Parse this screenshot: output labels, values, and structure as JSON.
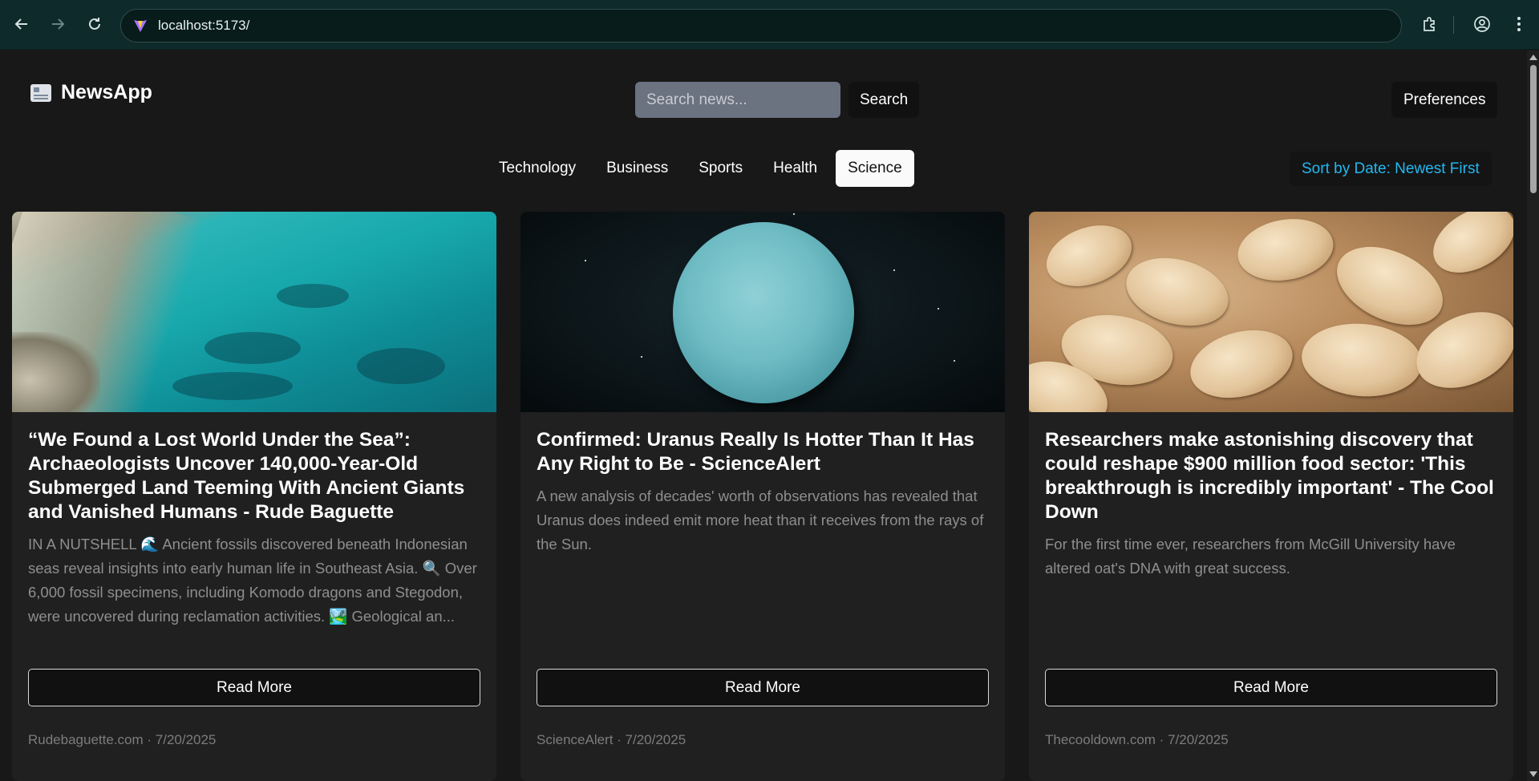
{
  "browser": {
    "url": "localhost:5173/"
  },
  "header": {
    "app_name": "NewsApp",
    "search_placeholder": "Search news...",
    "search_label": "Search",
    "preferences_label": "Preferences"
  },
  "categories": [
    {
      "label": "Technology",
      "active": false
    },
    {
      "label": "Business",
      "active": false
    },
    {
      "label": "Sports",
      "active": false
    },
    {
      "label": "Health",
      "active": false
    },
    {
      "label": "Science",
      "active": true
    }
  ],
  "sort_label": "Sort by Date: Newest First",
  "colors": {
    "accent": "#22b8f0",
    "card_bg": "#202020",
    "page_bg": "#181818"
  },
  "articles": [
    {
      "title": "“We Found a Lost World Under the Sea”: Archaeologists Uncover 140,000-Year-Old Submerged Land Teeming With Ancient Giants and Vanished Humans - Rude Baguette",
      "description": "IN A NUTSHELL 🌊 Ancient fossils discovered beneath Indonesian seas reveal insights into early human life in Southeast Asia. 🔍 Over 6,000 fossil specimens, including Komodo dragons and Stegodon, were uncovered during reclamation activities. 🏞️ Geological an...",
      "read_more": "Read More",
      "meta": "Rudebaguette.com · 7/20/2025"
    },
    {
      "title": "Confirmed: Uranus Really Is Hotter Than It Has Any Right to Be - ScienceAlert",
      "description": "A new analysis of decades' worth of observations has revealed that Uranus does indeed emit more heat than it receives from the rays of the Sun.",
      "read_more": "Read More",
      "meta": "ScienceAlert · 7/20/2025"
    },
    {
      "title": "Researchers make astonishing discovery that could reshape $900 million food sector: 'This breakthrough is incredibly important' - The Cool Down",
      "description": "For the first time ever, researchers from McGill University have altered oat's DNA with great success.",
      "read_more": "Read More",
      "meta": "Thecooldown.com · 7/20/2025"
    }
  ]
}
